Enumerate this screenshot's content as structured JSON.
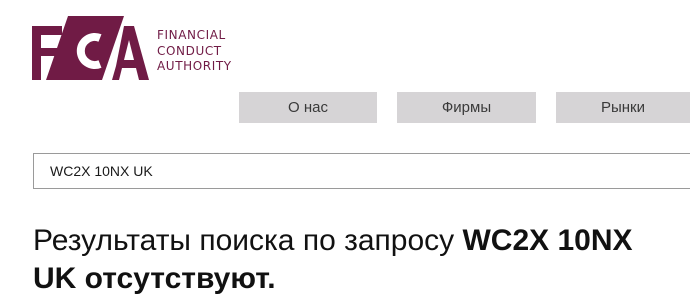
{
  "brand": {
    "logo_letters": "FCA",
    "name_lines": [
      "FINANCIAL",
      "CONDUCT",
      "AUTHORITY"
    ],
    "color": "#701b45"
  },
  "nav": {
    "items": [
      {
        "label": "О нас"
      },
      {
        "label": "Фирмы"
      },
      {
        "label": "Рынки"
      }
    ],
    "tab_bg": "#d6d4d6"
  },
  "search": {
    "value": "WC2X 10NX UK"
  },
  "results": {
    "prefix": "Результаты поиска по запросу ",
    "query": "WC2X 10NX UK",
    "suffix": " отсутствуют."
  }
}
